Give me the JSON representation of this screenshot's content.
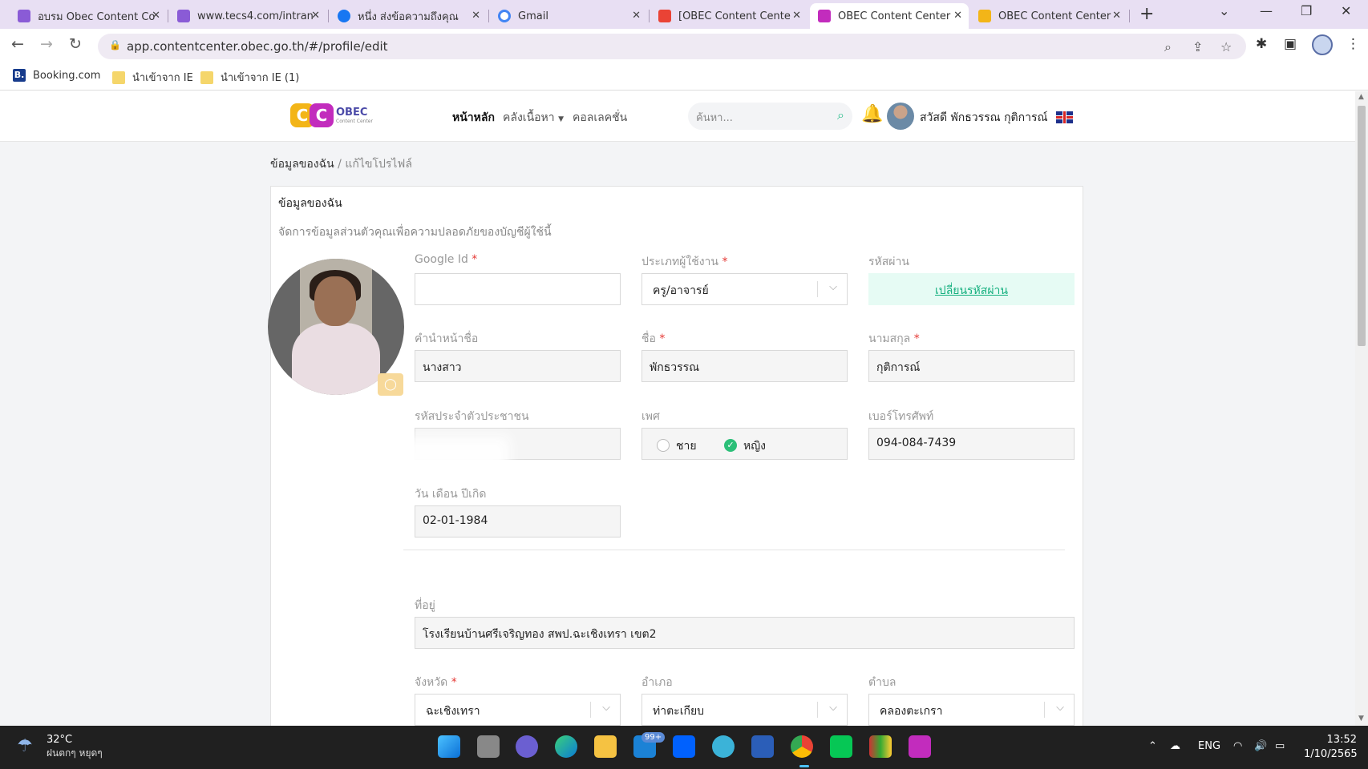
{
  "browser": {
    "tabs": [
      {
        "title": "อบรม Obec Content Co",
        "active": false,
        "favicon_color": "#8a5bd6"
      },
      {
        "title": "www.tecs4.com/intran",
        "active": false,
        "favicon_color": "#8a5bd6"
      },
      {
        "title": "หนึ่ง ส่งข้อความถึงคุณ",
        "active": false,
        "favicon_color": "#1877f2"
      },
      {
        "title": "Gmail",
        "active": false,
        "favicon_color": "#ea4335"
      },
      {
        "title": "[OBEC Content Cente",
        "active": false,
        "favicon_color": "#ea4335"
      },
      {
        "title": "OBEC Content Center",
        "active": true,
        "favicon_color": "#c22cbd"
      },
      {
        "title": "OBEC Content Center",
        "active": false,
        "favicon_color": "#f3b518"
      }
    ],
    "url": "app.contentcenter.obec.go.th/#/profile/edit",
    "bookmarks": [
      {
        "label": "Booking.com",
        "icon": "booking-icon"
      },
      {
        "label": "นำเข้าจาก IE",
        "icon": "folder-icon"
      },
      {
        "label": "นำเข้าจาก IE (1)",
        "icon": "folder-icon"
      }
    ]
  },
  "site": {
    "logo_text": "OBEC",
    "logo_sub": "Content Center",
    "nav": [
      {
        "label": "หน้าหลัก",
        "active": true
      },
      {
        "label": "คลังเนื้อหา",
        "active": false,
        "dropdown": true
      },
      {
        "label": "คอลเลคชั่น",
        "active": false
      }
    ],
    "search_placeholder": "ค้นหา...",
    "greeting": "สวัสดี พักธวรรณ กุติการณ์",
    "accent": "#2bbf78"
  },
  "breadcrumb": {
    "root": "ข้อมูลของฉัน",
    "sep": " / ",
    "current": "แก้ไขโปรไฟล์"
  },
  "profile": {
    "title": "ข้อมูลของฉัน",
    "description": "จัดการข้อมูลส่วนตัวคุณเพื่อความปลอดภัยของบัญชีผู้ใช้นี้",
    "google_id": {
      "label": "Google Id",
      "value": ""
    },
    "user_type": {
      "label": "ประเภทผู้ใช้งาน",
      "value": "ครู/อาจารย์"
    },
    "password": {
      "label": "รหัสผ่าน",
      "button": "เปลี่ยนรหัสผ่าน"
    },
    "prefix": {
      "label": "คำนำหน้าชื่อ",
      "value": "นางสาว"
    },
    "first_name": {
      "label": "ชื่อ",
      "value": "พักธวรรณ"
    },
    "last_name": {
      "label": "นามสกุล",
      "value": "กุติการณ์"
    },
    "citizen_id": {
      "label": "รหัสประจำตัวประชาชน",
      "value": ""
    },
    "gender": {
      "label": "เพศ",
      "options": [
        "ชาย",
        "หญิง"
      ],
      "selected": "หญิง"
    },
    "phone": {
      "label": "เบอร์โทรศัพท์",
      "value": "094-084-7439"
    },
    "birthdate": {
      "label": "วัน เดือน ปีเกิด",
      "value": "02-01-1984"
    },
    "address": {
      "label": "ที่อยู่",
      "value": "โรงเรียนบ้านศรีเจริญทอง สพป.ฉะเชิงเทรา เขต2"
    },
    "province": {
      "label": "จังหวัด",
      "value": "ฉะเชิงเทรา"
    },
    "district": {
      "label": "อำเภอ",
      "value": "ท่าตะเกียบ"
    },
    "subdistrict": {
      "label": "ตำบล",
      "value": "คลองตะเกรา"
    },
    "required_mark": "*"
  },
  "taskbar": {
    "temp": "32°C",
    "weather": "ฝนตกๆ หยุดๆ",
    "mail_badge": "99+",
    "lang": "ENG",
    "time": "13:52",
    "date": "1/10/2565"
  }
}
